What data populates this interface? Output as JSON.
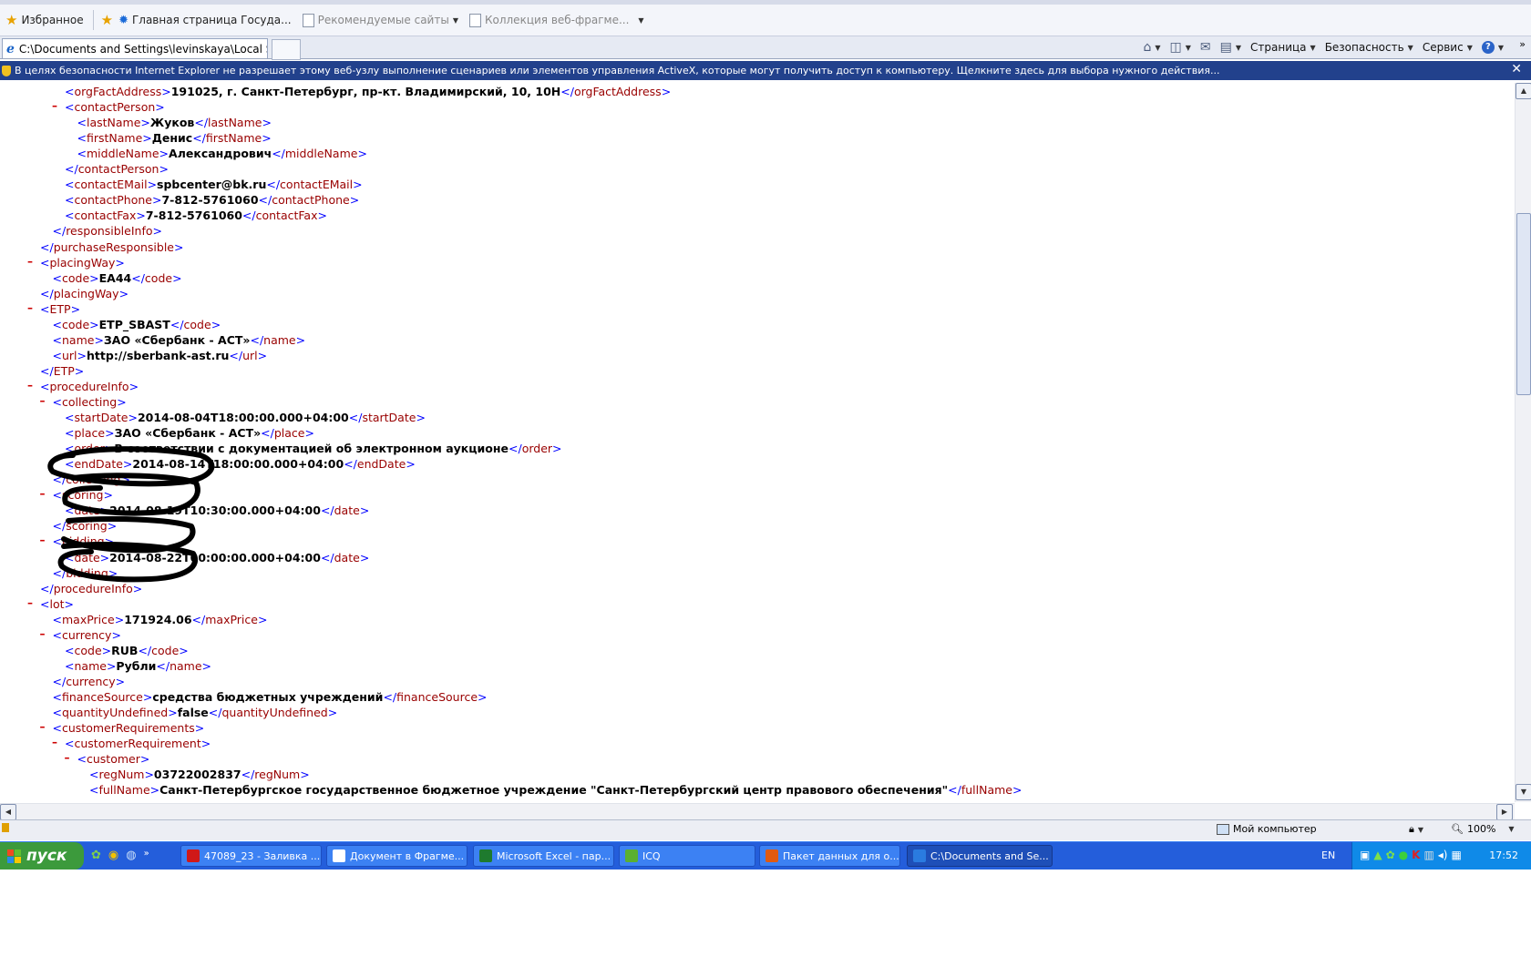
{
  "favorites": {
    "label": "Избранное",
    "items": [
      {
        "label": "Главная страница  Госуда...",
        "icon": "globe-icon"
      },
      {
        "label": "Рекомендуемые сайты",
        "icon": "page-icon"
      },
      {
        "label": "Коллекция веб-фрагме...",
        "icon": "page-icon"
      }
    ]
  },
  "tab": {
    "title": "C:\\Documents and Settings\\levinskaya\\Local Settings\\..."
  },
  "commands": {
    "page": "Страница",
    "security": "Безопасность",
    "service": "Сервис"
  },
  "infobar": {
    "text": "В целях безопасности Internet Explorer не разрешает этому веб-узлу выполнение сценариев или элементов управления ActiveX, которые могут получить доступ к компьютеру. Щелкните здесь для выбора нужного действия...",
    "close": "✕"
  },
  "xml": [
    {
      "ind": 0,
      "type": "val",
      "tag": "orgFactAddress",
      "value": "191025, г. Санкт-Петербург, пр-кт. Владимирский, 10, 10Н"
    },
    {
      "ind": 0,
      "type": "open",
      "tag": "contactPerson",
      "minus": true
    },
    {
      "ind": 1,
      "type": "val",
      "tag": "lastName",
      "value": "Жуков"
    },
    {
      "ind": 1,
      "type": "val",
      "tag": "firstName",
      "value": "Денис"
    },
    {
      "ind": 1,
      "type": "val",
      "tag": "middleName",
      "value": "Александрович"
    },
    {
      "ind": 0,
      "type": "close",
      "tag": "contactPerson"
    },
    {
      "ind": 0,
      "type": "val",
      "tag": "contactEMail",
      "value": "spbcenter@bk.ru"
    },
    {
      "ind": 0,
      "type": "val",
      "tag": "contactPhone",
      "value": "7-812-5761060"
    },
    {
      "ind": 0,
      "type": "val",
      "tag": "contactFax",
      "value": "7-812-5761060"
    },
    {
      "ind": -1,
      "type": "close",
      "tag": "responsibleInfo"
    },
    {
      "ind": -2,
      "type": "close",
      "tag": "purchaseResponsible"
    },
    {
      "ind": -2,
      "type": "open",
      "tag": "placingWay",
      "minus": true
    },
    {
      "ind": -1,
      "type": "val",
      "tag": "code",
      "value": "EA44"
    },
    {
      "ind": -2,
      "type": "close",
      "tag": "placingWay"
    },
    {
      "ind": -2,
      "type": "open",
      "tag": "ETP",
      "minus": true
    },
    {
      "ind": -1,
      "type": "val",
      "tag": "code",
      "value": "ETP_SBAST"
    },
    {
      "ind": -1,
      "type": "val",
      "tag": "name",
      "value": "ЗАО «Сбербанк - АСТ»"
    },
    {
      "ind": -1,
      "type": "val",
      "tag": "url",
      "value": "http://sberbank-ast.ru"
    },
    {
      "ind": -2,
      "type": "close",
      "tag": "ETP"
    },
    {
      "ind": -2,
      "type": "open",
      "tag": "procedureInfo",
      "minus": true
    },
    {
      "ind": -1,
      "type": "open",
      "tag": "collecting",
      "minus": true
    },
    {
      "ind": 0,
      "type": "val",
      "tag": "startDate",
      "value": "2014-08-04T18:00:00.000+04:00"
    },
    {
      "ind": 0,
      "type": "val",
      "tag": "place",
      "value": "ЗАО «Сбербанк - АСТ»"
    },
    {
      "ind": 0,
      "type": "val",
      "tag": "order",
      "value": "В соответствии с документацией об электронном аукционе"
    },
    {
      "ind": 0,
      "type": "val",
      "tag": "endDate",
      "value": "2014-08-14T18:00:00.000+04:00"
    },
    {
      "ind": -1,
      "type": "close",
      "tag": "collecting"
    },
    {
      "ind": -1,
      "type": "open",
      "tag": "scoring",
      "minus": true
    },
    {
      "ind": 0,
      "type": "val",
      "tag": "date",
      "value": "2014-08-19T10:30:00.000+04:00"
    },
    {
      "ind": -1,
      "type": "close",
      "tag": "scoring"
    },
    {
      "ind": -1,
      "type": "open",
      "tag": "bidding",
      "minus": true
    },
    {
      "ind": 0,
      "type": "val",
      "tag": "date",
      "value": "2014-08-22T00:00:00.000+04:00"
    },
    {
      "ind": -1,
      "type": "close",
      "tag": "bidding"
    },
    {
      "ind": -2,
      "type": "close",
      "tag": "procedureInfo"
    },
    {
      "ind": -2,
      "type": "open",
      "tag": "lot",
      "minus": true
    },
    {
      "ind": -1,
      "type": "val",
      "tag": "maxPrice",
      "value": "171924.06"
    },
    {
      "ind": -1,
      "type": "open",
      "tag": "currency",
      "minus": true
    },
    {
      "ind": 0,
      "type": "val",
      "tag": "code",
      "value": "RUB"
    },
    {
      "ind": 0,
      "type": "val",
      "tag": "name",
      "value": "Рубли"
    },
    {
      "ind": -1,
      "type": "close",
      "tag": "currency"
    },
    {
      "ind": -1,
      "type": "val",
      "tag": "financeSource",
      "value": "средства бюджетных учреждений"
    },
    {
      "ind": -1,
      "type": "val",
      "tag": "quantityUndefined",
      "value": "false"
    },
    {
      "ind": -1,
      "type": "open",
      "tag": "customerRequirements",
      "minus": true
    },
    {
      "ind": 0,
      "type": "open",
      "tag": "customerRequirement",
      "minus": true
    },
    {
      "ind": 1,
      "type": "open",
      "tag": "customer",
      "minus": true
    },
    {
      "ind": 2,
      "type": "val",
      "tag": "regNum",
      "value": "03722002837"
    },
    {
      "ind": 2,
      "type": "val",
      "tag": "fullName",
      "value": "Санкт-Петербургское государственное бюджетное учреждение \"Санкт-Петербургский центр правового обеспечения\""
    }
  ],
  "status": {
    "zone": "Мой компьютер",
    "zoom": "100%"
  },
  "taskbar": {
    "start": "пуск",
    "tasks": [
      {
        "label": "47089_23 - Заливка ...",
        "color": "#d01818"
      },
      {
        "label": "Документ в Фрагме...",
        "color": "#ffffff"
      },
      {
        "label": "Microsoft Excel - пар...",
        "color": "#1e7a2e"
      },
      {
        "label": "ICQ",
        "color": "#5ab030"
      },
      {
        "label": "Пакет данных для о...",
        "color": "#e05a10"
      },
      {
        "label": "C:\\Documents and Se...",
        "color": "#2a7be0"
      }
    ],
    "lang": "EN",
    "time": "17:52"
  }
}
